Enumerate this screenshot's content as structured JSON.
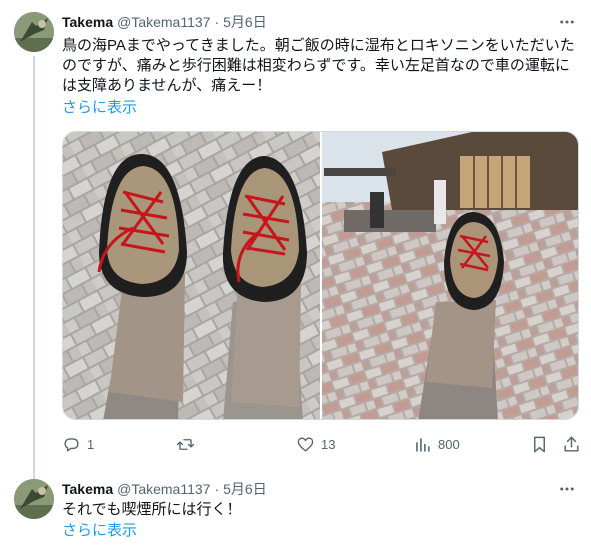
{
  "tweets": [
    {
      "name": "Takema",
      "handle": "@Takema1137",
      "separator": "·",
      "date": "5月6日",
      "text": "鳥の海PAまでやってきました。朝ご飯の時に湿布とロキソニンをいただいたのですが、痛みと歩行困難は相変わらずです。幸い左足首なので車の運転には支障ありませんが、痛えー！",
      "show_more": "さらに表示",
      "actions": {
        "reply_count": "1",
        "retweet_count": "",
        "like_count": "13",
        "views_count": "800"
      }
    },
    {
      "name": "Takema",
      "handle": "@Takema1137",
      "separator": "·",
      "date": "5月6日",
      "text": "それでも喫煙所には行く！",
      "show_more": "さらに表示"
    }
  ],
  "icons": {
    "more": "more-horizontal-icon",
    "reply": "reply-icon",
    "retweet": "retweet-icon",
    "like": "heart-icon",
    "views": "views-icon",
    "bookmark": "bookmark-icon",
    "share": "share-icon"
  },
  "colors": {
    "text": "#0f1419",
    "secondary": "#536471",
    "link": "#1d9bf0",
    "border": "#cfd9de"
  }
}
